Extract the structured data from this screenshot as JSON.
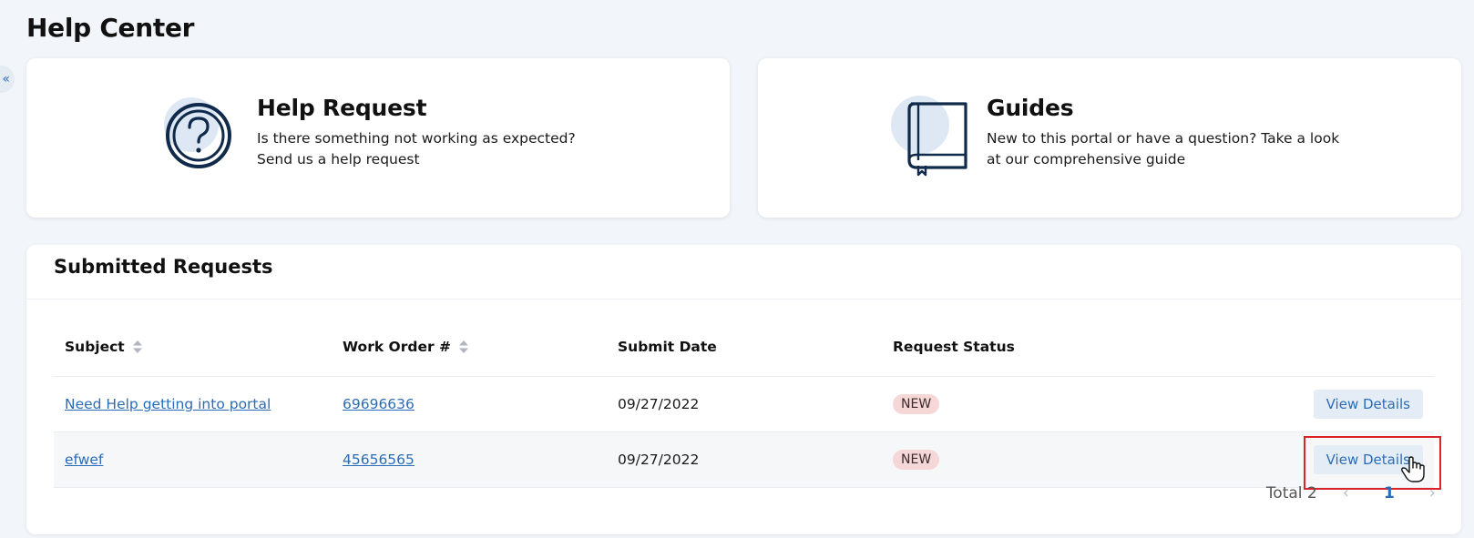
{
  "page": {
    "title": "Help Center"
  },
  "sidebar_toggle": {
    "glyph": "«"
  },
  "cards": {
    "help": {
      "title": "Help Request",
      "line1": "Is there something not working as expected?",
      "line2": "Send us a help request",
      "icon": "question-circle-icon"
    },
    "guides": {
      "title": "Guides",
      "line1": "New to this portal or have a question? Take a look",
      "line2": "at our comprehensive guide",
      "icon": "book-icon"
    }
  },
  "requests": {
    "title": "Submitted Requests",
    "columns": [
      "Subject",
      "Work Order #",
      "Submit Date",
      "Request Status"
    ],
    "rows": [
      {
        "subject": "Need Help getting into portal",
        "work_order": "69696636",
        "date": "09/27/2022",
        "status": "NEW",
        "action": "View Details"
      },
      {
        "subject": "efwef",
        "work_order": "45656565",
        "date": "09/27/2022",
        "status": "NEW",
        "action": "View Details"
      }
    ],
    "pagination": {
      "total_label": "Total 2",
      "current_page": "1",
      "prev": "‹",
      "next": "›"
    }
  },
  "colors": {
    "accent": "#2b6cb8",
    "icon_navy": "#0f2a4a",
    "icon_bg": "#dde8f4",
    "badge_bg": "#f6d7d7",
    "highlight": "#d9252a"
  }
}
